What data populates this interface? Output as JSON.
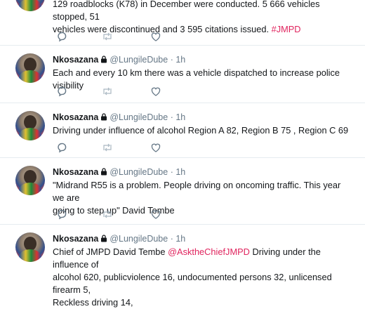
{
  "top_tweet": {
    "text_line1": "129 roadblocks (K78) in December were conducted. 5 666 vehicles stopped, 51",
    "text_line2_pre": "vehicles were discontinued and 3 595 citations issued. ",
    "hashtag": "#JMPD"
  },
  "tweets": [
    {
      "name": "Nkosazana",
      "handle": "@LungileDube",
      "dot": "·",
      "time": "1h",
      "text": "Each and every 10 km there was a vehicle dispatched to increase police visibility"
    },
    {
      "name": "Nkosazana",
      "handle": "@LungileDube",
      "dot": "·",
      "time": "1h",
      "text": "Driving under influence of alcohol Region A 82, Region B 75 , Region C 69"
    },
    {
      "name": "Nkosazana",
      "handle": "@LungileDube",
      "dot": "·",
      "time": "1h",
      "text_line1": "\"Midrand R55 is a problem. People driving on oncoming traffic. This year we are",
      "text_line2": "going to step up\" David Tembe"
    },
    {
      "name": "Nkosazana",
      "handle": "@LungileDube",
      "dot": "·",
      "time": "1h",
      "text_pre": "Chief of JMPD David Tembe ",
      "mention": "@AsktheChiefJMPD",
      "text_post": " Driving under the influence of",
      "text_line2": "alcohol 620, publicviolence 16, undocumented persons 32, unlicensed firearm 5,",
      "text_line3": "Reckless driving 14,"
    }
  ],
  "icons": {
    "reply": "reply-icon",
    "retweet": "retweet-icon",
    "like": "like-icon",
    "lock": "lock-icon"
  },
  "colors": {
    "link": "#e0245e",
    "muted": "#657786",
    "divider": "#e6ecf0"
  }
}
